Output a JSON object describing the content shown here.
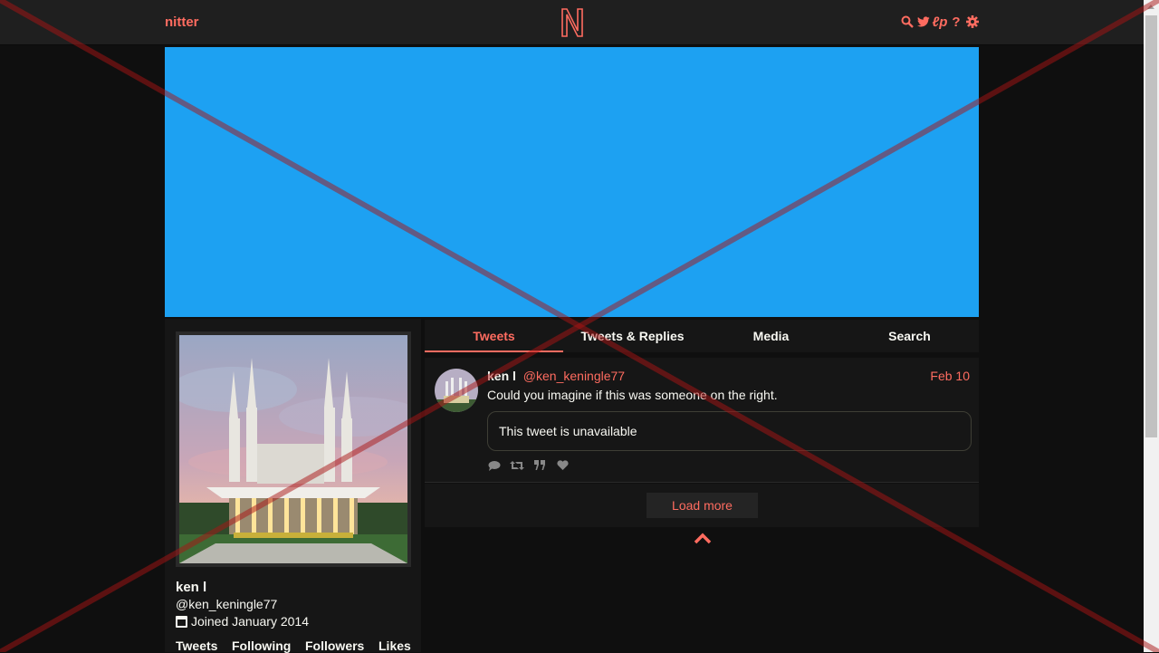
{
  "navbar": {
    "brand": "nitter",
    "logo_letter": "N",
    "icons": [
      "search-icon",
      "bird-icon",
      "rss-icon",
      "help-icon",
      "settings-icon"
    ],
    "icon_glyphs": {
      "rss": "ℓp",
      "help": "?"
    }
  },
  "colors": {
    "accent": "#ff6c60",
    "banner": "#1da1f2",
    "background": "#0f0f0f",
    "panel": "#161616"
  },
  "profile": {
    "fullname": "ken l",
    "username": "@ken_keningle77",
    "joined": "Joined January 2014",
    "stats": [
      "Tweets",
      "Following",
      "Followers",
      "Likes"
    ]
  },
  "tabs": [
    {
      "label": "Tweets",
      "active": true
    },
    {
      "label": "Tweets & Replies",
      "active": false
    },
    {
      "label": "Media",
      "active": false
    },
    {
      "label": "Search",
      "active": false
    }
  ],
  "tweet": {
    "fullname": "ken l",
    "username": "@ken_keningle77",
    "date": "Feb 10",
    "content": "Could you imagine if this was someone on the right.",
    "quote": "This tweet is unavailable",
    "actions": [
      "comment-icon",
      "retweet-icon",
      "quote-icon",
      "heart-icon"
    ]
  },
  "load_more": "Load more"
}
